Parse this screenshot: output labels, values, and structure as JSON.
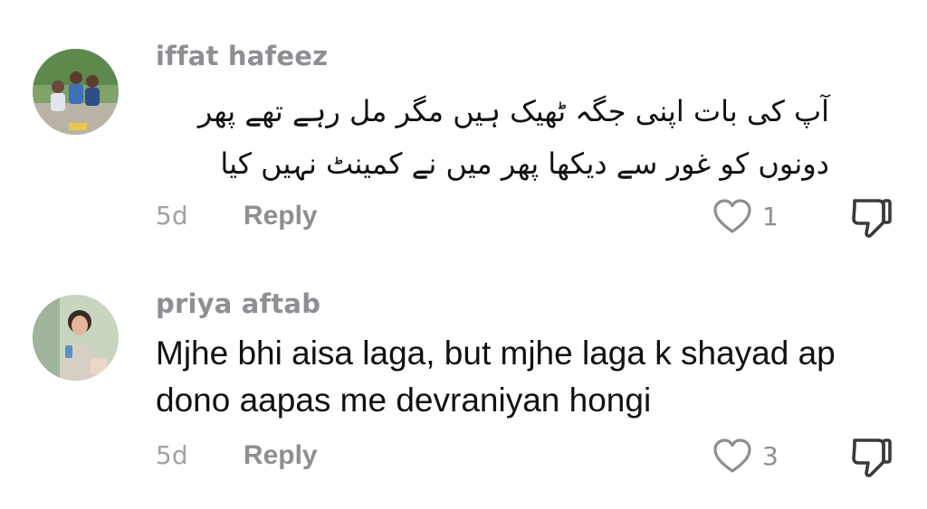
{
  "comments": [
    {
      "username": "iffat hafeez",
      "text": "آپ کی بات اپنی جگہ ٹھیک ہیں مگر مل رہے تھے پھر دونوں کو غور سے دیکھا پھر میں نے کمینٹ نہیں کیا",
      "age": "5d",
      "reply_label": "Reply",
      "like_count": "1",
      "avatar_icon": "user-avatar-photo",
      "like_icon": "heart-outline-icon",
      "dislike_icon": "thumbs-down-icon"
    },
    {
      "username": "priya aftab",
      "text": "Mjhe bhi aisa laga, but mjhe laga k shayad ap dono aapas me devraniyan hongi",
      "age": "5d",
      "reply_label": "Reply",
      "like_count": "3",
      "avatar_icon": "user-avatar-photo",
      "like_icon": "heart-outline-icon",
      "dislike_icon": "thumbs-down-icon"
    }
  ],
  "colors": {
    "background": "#ffffff",
    "username": "#8e8e93",
    "text": "#111111",
    "meta": "#a1a1a6"
  }
}
